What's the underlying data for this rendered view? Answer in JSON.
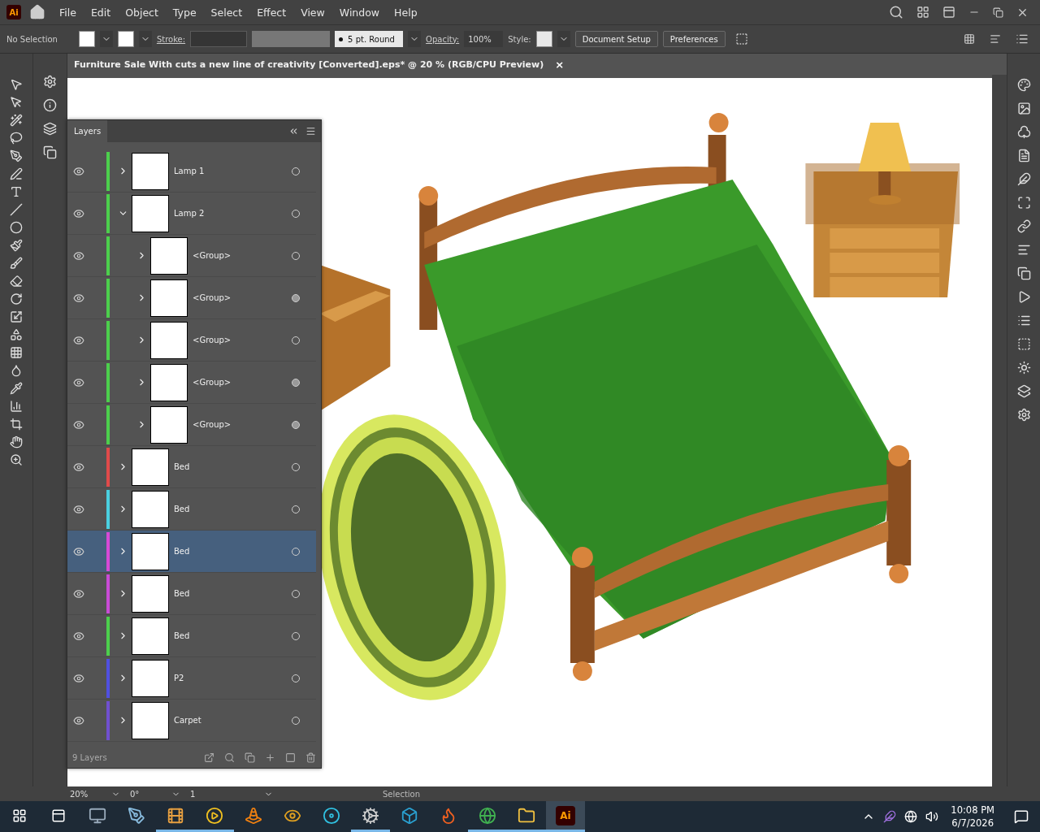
{
  "app": {
    "logo": "Ai",
    "menu": [
      "File",
      "Edit",
      "Object",
      "Type",
      "Select",
      "Effect",
      "View",
      "Window",
      "Help"
    ]
  },
  "control_bar": {
    "selection": "No Selection",
    "stroke_label": "Stroke:",
    "brush": "5 pt. Round",
    "opacity_label": "Opacity:",
    "opacity": "100%",
    "style_label": "Style:",
    "buttons": [
      "Document Setup",
      "Preferences"
    ]
  },
  "document_tab": {
    "title": "Furniture Sale With cuts a new line of creativity [Converted].eps* @ 20 % (RGB/CPU Preview)",
    "close": "×"
  },
  "layers_panel": {
    "title": "Layers",
    "footer": "9 Layers",
    "layers": [
      {
        "name": "Lamp 1",
        "color": "#4ccf4c",
        "visible": true,
        "expanded": false,
        "selected": false,
        "has_appearance": false
      },
      {
        "name": "Lamp 2",
        "color": "#4ccf4c",
        "visible": true,
        "expanded": true,
        "selected": false,
        "has_appearance": false,
        "children": [
          {
            "name": "<Group>",
            "color": "#4ccf4c",
            "visible": true,
            "expanded": false,
            "selected": false,
            "has_appearance": false
          },
          {
            "name": "<Group>",
            "color": "#4ccf4c",
            "visible": true,
            "expanded": false,
            "selected": false,
            "has_appearance": true
          },
          {
            "name": "<Group>",
            "color": "#4ccf4c",
            "visible": true,
            "expanded": false,
            "selected": false,
            "has_appearance": false
          },
          {
            "name": "<Group>",
            "color": "#4ccf4c",
            "visible": true,
            "expanded": false,
            "selected": false,
            "has_appearance": true
          },
          {
            "name": "<Group>",
            "color": "#4ccf4c",
            "visible": true,
            "expanded": false,
            "selected": false,
            "has_appearance": true
          }
        ]
      },
      {
        "name": "Bed",
        "color": "#e04a4a",
        "visible": true,
        "expanded": false,
        "selected": false,
        "has_appearance": false
      },
      {
        "name": "Bed",
        "color": "#4ad0e0",
        "visible": true,
        "expanded": false,
        "selected": false,
        "has_appearance": false
      },
      {
        "name": "Bed",
        "color": "#d64ad6",
        "visible": true,
        "expanded": false,
        "selected": true,
        "has_appearance": false
      },
      {
        "name": "Bed",
        "color": "#c94bd6",
        "visible": true,
        "expanded": false,
        "selected": false,
        "has_appearance": false
      },
      {
        "name": "Bed",
        "color": "#4ccf4c",
        "visible": true,
        "expanded": false,
        "selected": false,
        "has_appearance": false
      },
      {
        "name": "P2",
        "color": "#5050e0",
        "visible": true,
        "expanded": false,
        "selected": false,
        "has_appearance": false
      },
      {
        "name": "Carpet",
        "color": "#7050d0",
        "visible": true,
        "expanded": false,
        "selected": false,
        "has_appearance": false
      }
    ]
  },
  "status_bar": {
    "zoom": "20%",
    "rotation": "0°",
    "artboard": "1",
    "tool": "Selection"
  },
  "taskbar": {
    "apps": [
      {
        "kind": "monitor",
        "running": false,
        "selected": false
      },
      {
        "kind": "pen",
        "running": false,
        "selected": false
      },
      {
        "kind": "film",
        "running": true,
        "selected": false
      },
      {
        "kind": "player",
        "running": true,
        "selected": false
      },
      {
        "kind": "cone",
        "running": false,
        "selected": false
      },
      {
        "kind": "eye",
        "running": false,
        "selected": false
      },
      {
        "kind": "reel",
        "running": false,
        "selected": false
      },
      {
        "kind": "gear",
        "running": true,
        "selected": false
      },
      {
        "kind": "box",
        "running": false,
        "selected": false
      },
      {
        "kind": "flame",
        "running": false,
        "selected": false
      },
      {
        "kind": "globe",
        "running": true,
        "selected": false
      },
      {
        "kind": "folder",
        "running": true,
        "selected": false
      },
      {
        "kind": "logo",
        "label": "Ai",
        "running": true,
        "selected": true
      }
    ],
    "time": "10:08 PM",
    "date": "6/7/2026"
  }
}
